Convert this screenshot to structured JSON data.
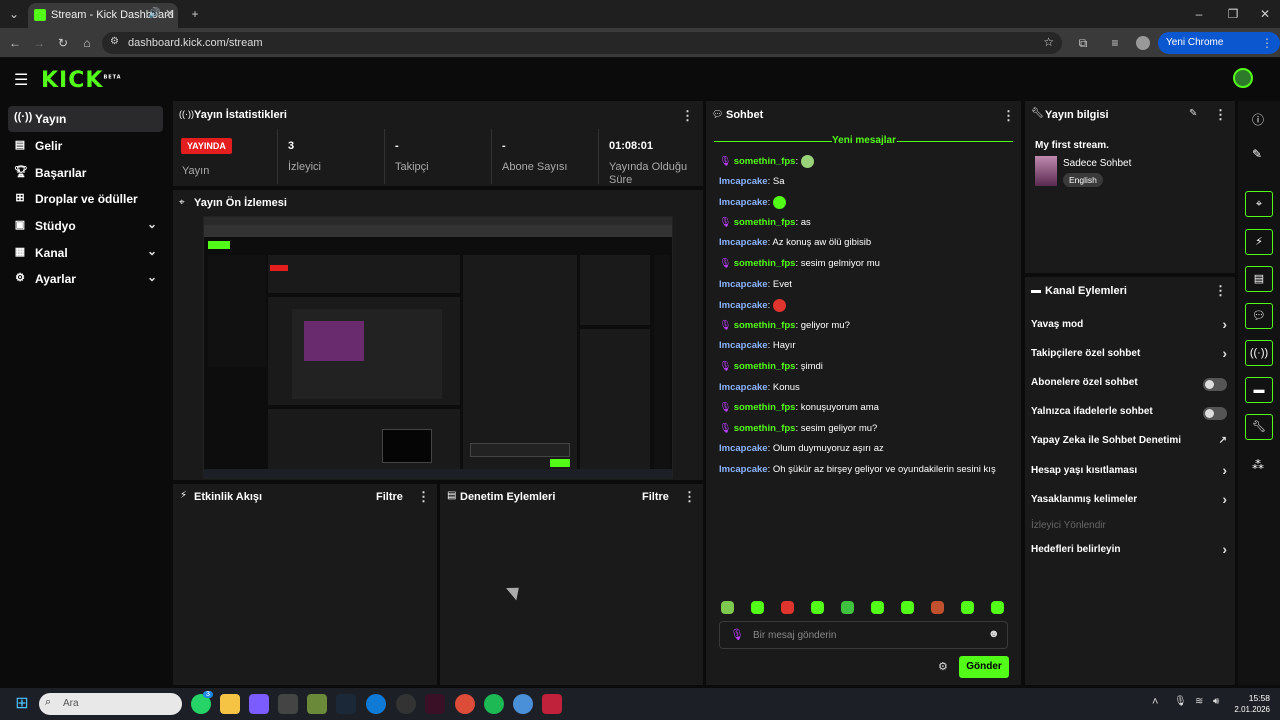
{
  "browser": {
    "tab_title": "Stream - Kick Dashboard",
    "url": "dashboard.kick.com/stream",
    "update_button": "Yeni Chrome kullanılabilir"
  },
  "brand": {
    "logo": "KICK",
    "beta": "BETA"
  },
  "sidebar": {
    "items": [
      {
        "label": "Yayın",
        "icon": "broadcast-icon",
        "active": true
      },
      {
        "label": "Gelir",
        "icon": "revenue-icon"
      },
      {
        "label": "Başarılar",
        "icon": "trophy-icon"
      },
      {
        "label": "Droplar ve ödüller",
        "icon": "drops-icon"
      },
      {
        "label": "Stüdyo",
        "icon": "studio-icon",
        "expandable": true
      },
      {
        "label": "Kanal",
        "icon": "channel-icon",
        "expandable": true
      },
      {
        "label": "Ayarlar",
        "icon": "gear-icon",
        "expandable": true
      }
    ]
  },
  "stats": {
    "title": "Yayın İstatistikleri",
    "live_badge": "YAYINDA",
    "items": [
      {
        "value": "",
        "label": "Yayın"
      },
      {
        "value": "3",
        "label": "İzleyici"
      },
      {
        "value": "-",
        "label": "Takipçi"
      },
      {
        "value": "-",
        "label": "Abone Sayısı"
      },
      {
        "value": "01:08:01",
        "label": "Yayında Olduğu Süre"
      }
    ]
  },
  "preview": {
    "title": "Yayın Ön İzlemesi"
  },
  "activity": {
    "title": "Etkinlik Akışı",
    "filter": "Filtre"
  },
  "moderation": {
    "title": "Denetim Eylemleri",
    "filter": "Filtre"
  },
  "chat": {
    "title": "Sohbet",
    "new_messages": "Yeni mesajlar",
    "messages": [
      {
        "user": "somethin_fps",
        "text": "",
        "style": "a",
        "emote": "#9ad27a"
      },
      {
        "user": "Imcapcake",
        "text": "Sa",
        "style": "b"
      },
      {
        "user": "Imcapcake",
        "text": "",
        "style": "b",
        "emote": "#53fc18"
      },
      {
        "user": "somethin_fps",
        "text": "as",
        "style": "a"
      },
      {
        "user": "Imcapcake",
        "text": "Az konuş aw ölü gibisib",
        "style": "b"
      },
      {
        "user": "somethin_fps",
        "text": "sesim gelmiyor mu",
        "style": "a"
      },
      {
        "user": "Imcapcake",
        "text": "Evet",
        "style": "b"
      },
      {
        "user": "Imcapcake",
        "text": "",
        "style": "b",
        "emote": "#e0342e"
      },
      {
        "user": "somethin_fps",
        "text": "geliyor mu?",
        "style": "a"
      },
      {
        "user": "Imcapcake",
        "text": "Hayır",
        "style": "b"
      },
      {
        "user": "somethin_fps",
        "text": "şimdi",
        "style": "a"
      },
      {
        "user": "Imcapcake",
        "text": "Konus",
        "style": "b"
      },
      {
        "user": "somethin_fps",
        "text": "konuşuyorum ama",
        "style": "a"
      },
      {
        "user": "somethin_fps",
        "text": "sesim geliyor mu?",
        "style": "a"
      },
      {
        "user": "Imcapcake",
        "text": "Olum duymuyoruz aşırı az",
        "style": "b"
      },
      {
        "user": "Imcapcake",
        "text": "Oh şükür az birşey geliyor ve oyundakilerin sesini kış",
        "style": "b"
      }
    ],
    "emote_colors": [
      "#7ec850",
      "#53fc18",
      "#e0342e",
      "#53fc18",
      "#3ec240",
      "#53fc18",
      "#53fc18",
      "#c0502e",
      "#53fc18",
      "#53fc18"
    ],
    "input_placeholder": "Bir mesaj gönderin",
    "send_button": "Gönder"
  },
  "stream_info": {
    "title": "Yayın bilgisi",
    "stream_title": "My first stream.",
    "category": "Sadece Sohbet",
    "language": "English"
  },
  "channel_actions": {
    "title": "Kanal Eylemleri",
    "items": [
      {
        "label": "Yavaş mod",
        "control": "arrow"
      },
      {
        "label": "Takipçilere özel sohbet",
        "control": "arrow"
      },
      {
        "label": "Abonelere özel sohbet",
        "control": "toggle"
      },
      {
        "label": "Yalnızca ifadelerle sohbet",
        "control": "toggle"
      },
      {
        "label": "Yapay Zeka ile Sohbet Denetimi",
        "control": "external"
      },
      {
        "label": "Hesap yaşı kısıtlaması",
        "control": "arrow"
      },
      {
        "label": "Yasaklanmış kelimeler",
        "control": "arrow"
      },
      {
        "label": "İzleyici Yönlendir",
        "control": "disabled"
      },
      {
        "label": "Hedefleri belirleyin",
        "control": "arrow"
      }
    ]
  },
  "taskbar": {
    "search_placeholder": "Ara",
    "time": "15:58",
    "date": "2.01.2026",
    "whatsapp_badge": "3"
  }
}
